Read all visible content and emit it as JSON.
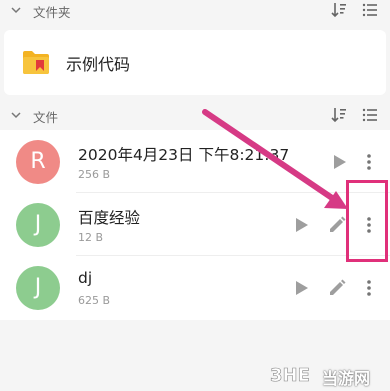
{
  "folders_section": {
    "title": "文件夹"
  },
  "folders": [
    {
      "name": "示例代码"
    }
  ],
  "files_section": {
    "title": "文件"
  },
  "files": [
    {
      "avatar_letter": "R",
      "avatar_color": "#f08a86",
      "name": "2020年4月23日 下午8:21:37",
      "size": "256 B"
    },
    {
      "avatar_letter": "J",
      "avatar_color": "#8dcc8f",
      "name": "百度经验",
      "size": "12 B"
    },
    {
      "avatar_letter": "J",
      "avatar_color": "#8dcc8f",
      "name": "dj",
      "size": "625 B"
    }
  ],
  "annotation": {
    "arrow_color": "#d63a85",
    "box_color": "#e0307a"
  },
  "watermark": {
    "logo": "3HE",
    "text": "当游网"
  }
}
